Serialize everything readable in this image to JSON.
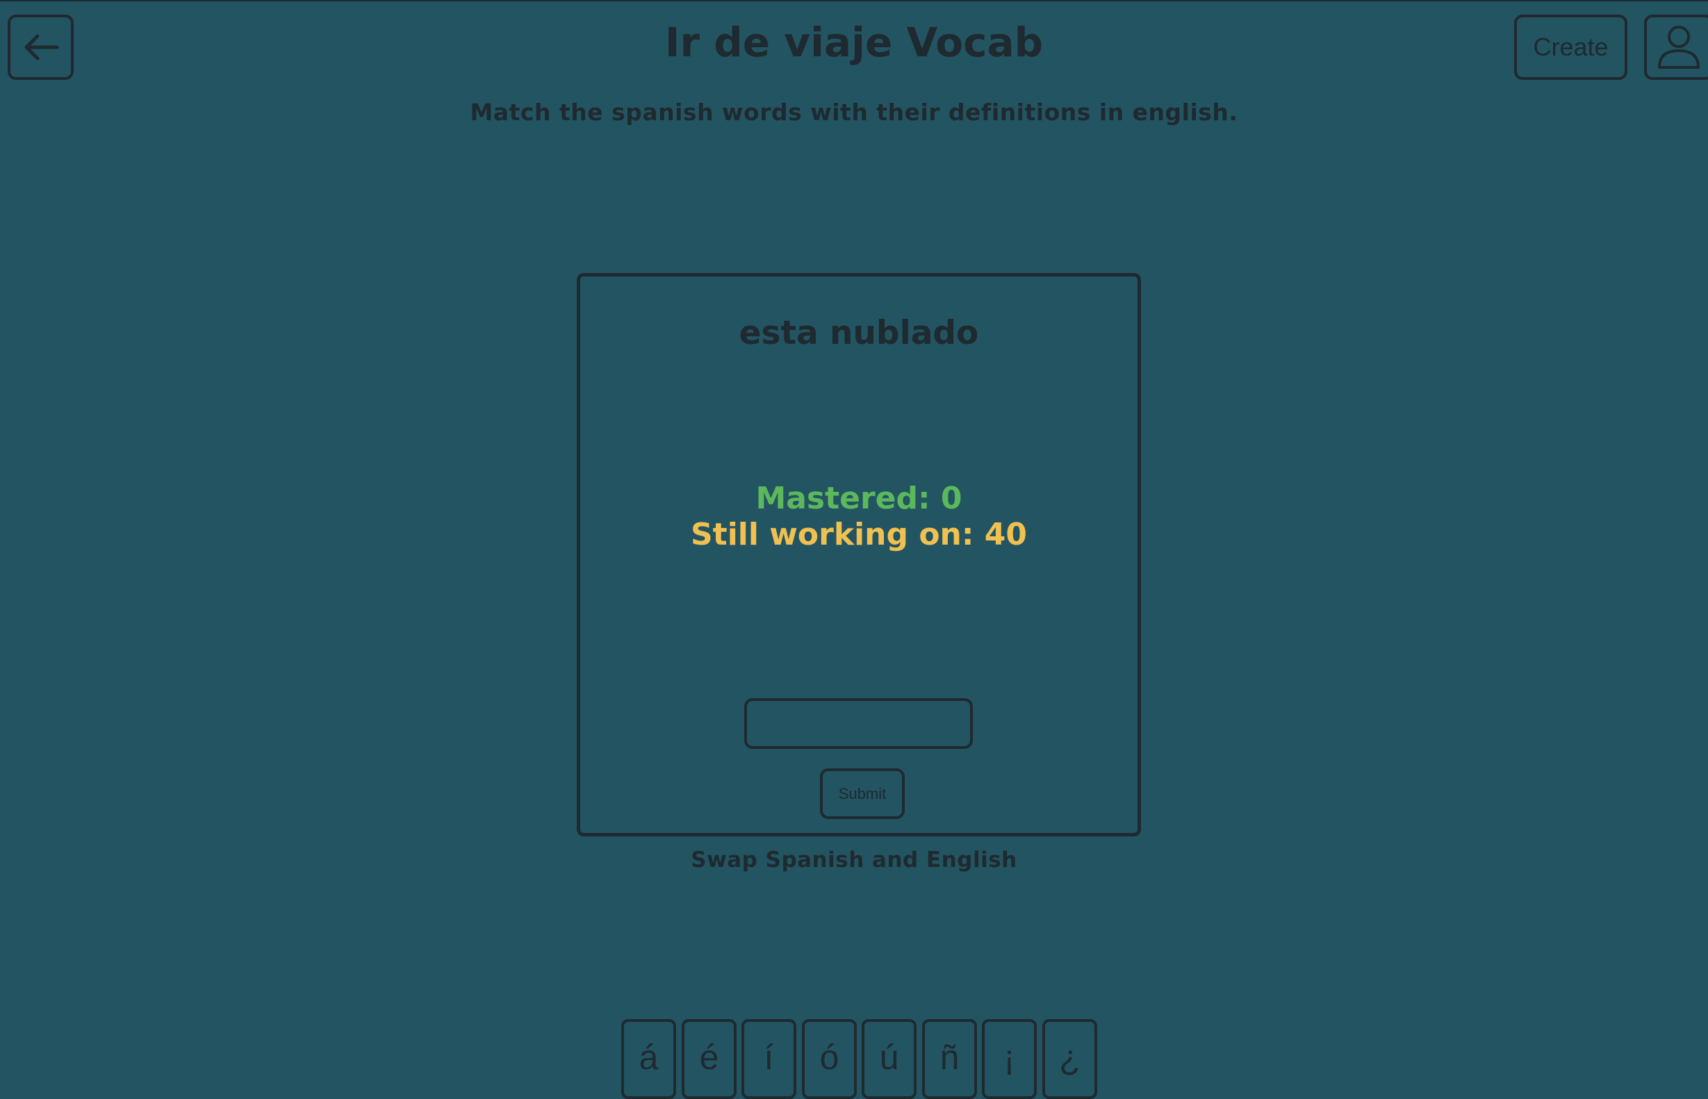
{
  "header": {
    "title": "Ir de viaje Vocab",
    "subtitle": "Match the spanish words with their definitions in english.",
    "create_label": "Create"
  },
  "card": {
    "term": "esta nublado",
    "mastered_text": "Mastered: 0",
    "working_text": "Still working on: 40",
    "answer_value": "",
    "submit_label": "Submit"
  },
  "swap_label": "Swap Spanish and English",
  "accent_keys": [
    "á",
    "é",
    "í",
    "ó",
    "ú",
    "ñ",
    "¡",
    "¿"
  ],
  "colors": {
    "background": "#235462",
    "ink": "#1e2a2f",
    "mastered": "#5cb85c",
    "working": "#f0c050"
  }
}
